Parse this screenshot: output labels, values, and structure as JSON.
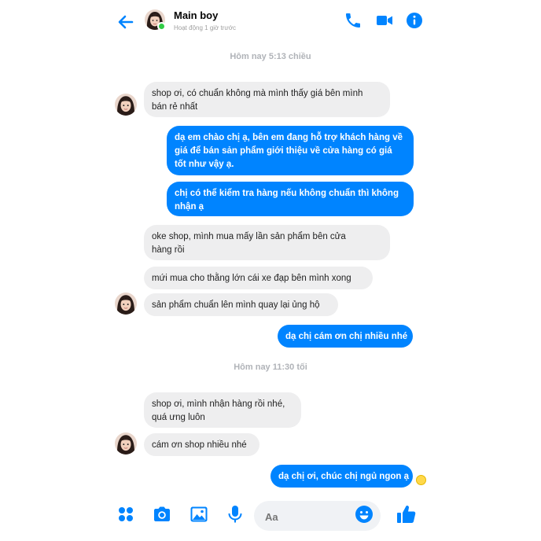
{
  "header": {
    "name": "Main boy",
    "status": "Hoạt động 1 giờ trước"
  },
  "timestamps": [
    "Hôm nay 5:13 chiều",
    "Hôm nay 11:30 tối"
  ],
  "messages": [
    {
      "from": "them",
      "text": "shop ơi, có chuẩn không mà mình thấy giá bên mình\nbán rẻ nhất"
    },
    {
      "from": "me",
      "text": "dạ em chào chị ạ, bên em đang hỗ trợ khách hàng về\ngiá để bán sản phẩm giới thiệu về cửa hàng có giá\ntốt như vậy ạ."
    },
    {
      "from": "me",
      "text": "chị có thể kiểm tra hàng nếu không chuẩn thì không\nnhận ạ"
    },
    {
      "from": "them",
      "text": "oke shop, mình mua mấy lần sản phẩm bên cửa\nhàng rồi"
    },
    {
      "from": "them",
      "text": "mứi mua cho thằng lớn cái xe đạp bên mình xong"
    },
    {
      "from": "them",
      "text": "sản phẩm chuẩn lên mình quay lại ủng hộ"
    },
    {
      "from": "me",
      "text": "dạ chị cám ơn chị nhiều nhé"
    },
    {
      "from": "them",
      "text": "shop ơi, mình nhận hàng rồi nhé,\nquá ưng luôn"
    },
    {
      "from": "them",
      "text": "cám ơn shop nhiều nhé"
    },
    {
      "from": "me",
      "text": "dạ chị ơi, chúc chị ngủ ngon ạ"
    }
  ],
  "composer": {
    "placeholder": "Aa"
  },
  "colors": {
    "accent": "#0084ff",
    "incoming_bg": "#eeeeef",
    "online": "#31cc46"
  },
  "icons": [
    "back-arrow-icon",
    "phone-icon",
    "video-icon",
    "info-icon",
    "apps-icon",
    "camera-icon",
    "image-icon",
    "microphone-icon",
    "emoji-icon",
    "thumbs-up-icon"
  ]
}
